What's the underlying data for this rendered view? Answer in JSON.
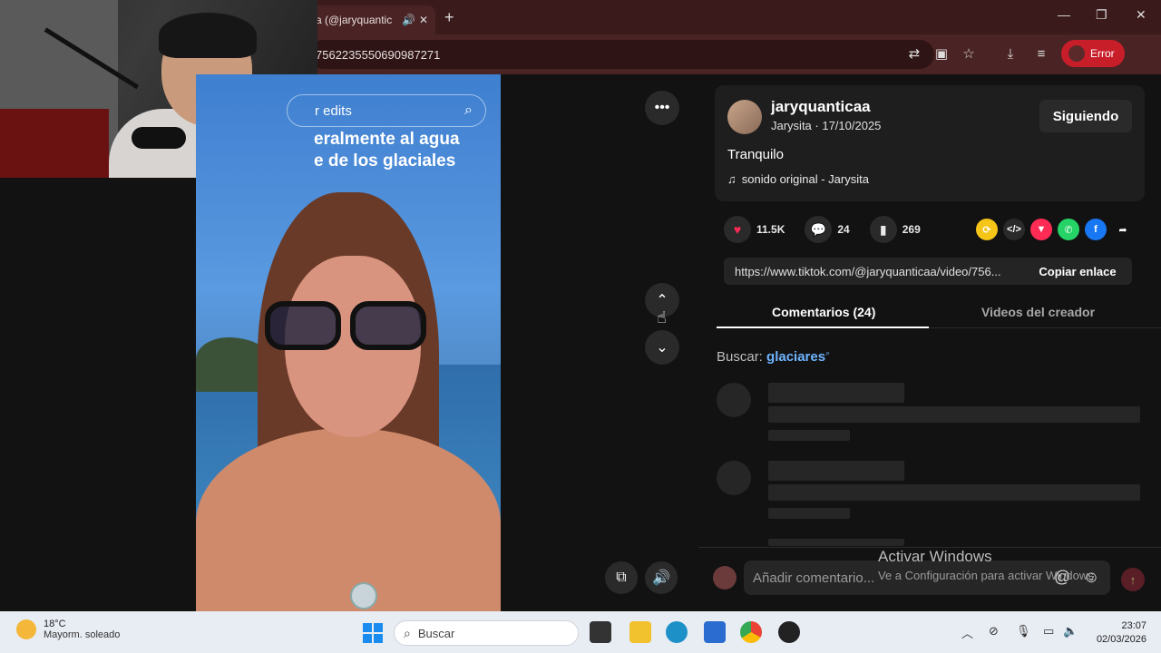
{
  "browser": {
    "tab_title": "a (@jaryquantic",
    "address": "7562235550690987271",
    "profile_label": "Error"
  },
  "video": {
    "search_text": "r edits",
    "caption_line1": "eralmente al agua",
    "caption_line2": "e de los glaciales"
  },
  "post": {
    "username": "jaryquanticaa",
    "meta": "Jarysita · 17/10/2025",
    "follow_label": "Siguiendo",
    "description": "Tranquilo",
    "sound": "sonido original - Jarysita",
    "likes": "11.5K",
    "comments": "24",
    "saves": "269",
    "link": "https://www.tiktok.com/@jaryquanticaa/video/756...",
    "copy_label": "Copiar enlace"
  },
  "tabs": {
    "comments": "Comentarios (24)",
    "creator_videos": "Videos del creador"
  },
  "search_suggest": {
    "label": "Buscar:",
    "keyword": "glaciares"
  },
  "comment_input": {
    "placeholder": "Añadir comentario..."
  },
  "windows_activation": {
    "line1": "Activar Windows",
    "line2": "Ve a Configuración para activar Windows."
  },
  "taskbar": {
    "temp": "18°C",
    "weather": "Mayorm. soleado",
    "search_placeholder": "Buscar",
    "time": "23:07",
    "date": "02/03/2026"
  },
  "colors": {
    "accent": "#fe2c55",
    "link": "#6fb4ff",
    "error_pill": "#c81e2a"
  }
}
